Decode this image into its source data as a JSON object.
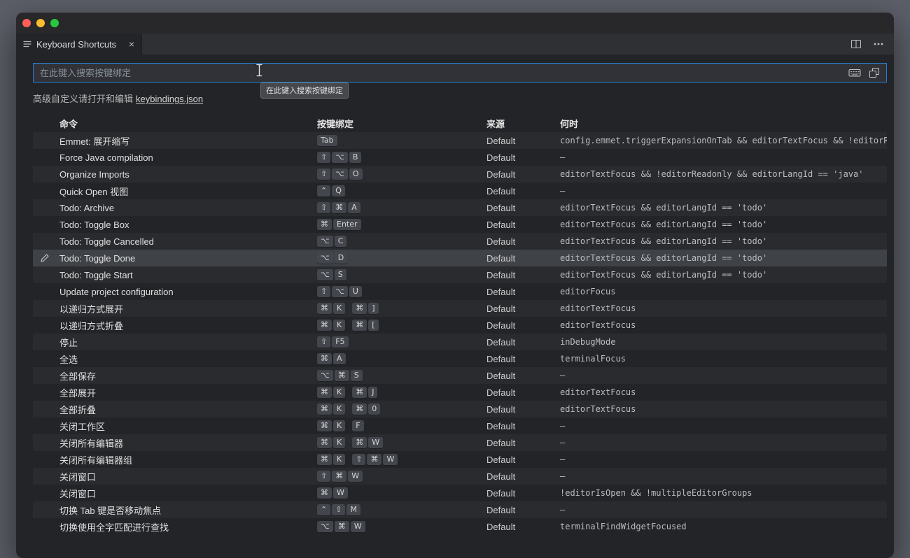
{
  "window": {
    "tab": {
      "label": "Keyboard Shortcuts",
      "close_glyph": "×"
    },
    "traffic_lights": {
      "close": "#ff5f57",
      "minimize": "#febc2e",
      "zoom": "#28c840"
    },
    "toolbar_icons": {
      "split_editor": "split-editor-icon",
      "more_actions": "more-actions-icon"
    }
  },
  "search": {
    "placeholder": "在此键入搜索按键绑定",
    "icons": {
      "record_keys": "keyboard-icon",
      "sort_by_precedence": "overlapping-squares-icon"
    }
  },
  "cursor_tooltip": {
    "text": "在此键入搜索按键绑定"
  },
  "advanced": {
    "text": "高级自定义请打开和编辑",
    "link": "keybindings.json"
  },
  "colors": {
    "focus_border": "#2a7ed2",
    "selected_row": "#3f4247",
    "alt_row": "#2a2b2f",
    "window_bg": "#232428"
  },
  "table": {
    "headers": {
      "command": "命令",
      "keybinding": "按键绑定",
      "source": "来源",
      "when": "何时"
    },
    "rows": [
      {
        "command": "Emmet: 展开缩写",
        "keys": [
          [
            "Tab"
          ]
        ],
        "source": "Default",
        "when": "config.emmet.triggerExpansionOnTab && editorTextFocus && !editorRe…"
      },
      {
        "command": "Force Java compilation",
        "keys": [
          [
            "⇧",
            "⌥",
            "B"
          ]
        ],
        "source": "Default",
        "when": "—"
      },
      {
        "command": "Organize Imports",
        "keys": [
          [
            "⇧",
            "⌥",
            "O"
          ]
        ],
        "source": "Default",
        "when": "editorTextFocus && !editorReadonly && editorLangId == 'java'"
      },
      {
        "command": "Quick Open 视图",
        "keys": [
          [
            "⌃",
            "Q"
          ]
        ],
        "source": "Default",
        "when": "—"
      },
      {
        "command": "Todo: Archive",
        "keys": [
          [
            "⇧",
            "⌘",
            "A"
          ]
        ],
        "source": "Default",
        "when": "editorTextFocus && editorLangId == 'todo'"
      },
      {
        "command": "Todo: Toggle Box",
        "keys": [
          [
            "⌘",
            "Enter"
          ]
        ],
        "source": "Default",
        "when": "editorTextFocus && editorLangId == 'todo'"
      },
      {
        "command": "Todo: Toggle Cancelled",
        "keys": [
          [
            "⌥",
            "C"
          ]
        ],
        "source": "Default",
        "when": "editorTextFocus && editorLangId == 'todo'"
      },
      {
        "command": "Todo: Toggle Done",
        "keys": [
          [
            "⌥",
            "D"
          ]
        ],
        "source": "Default",
        "when": "editorTextFocus && editorLangId == 'todo'",
        "selected": true
      },
      {
        "command": "Todo: Toggle Start",
        "keys": [
          [
            "⌥",
            "S"
          ]
        ],
        "source": "Default",
        "when": "editorTextFocus && editorLangId == 'todo'"
      },
      {
        "command": "Update project configuration",
        "keys": [
          [
            "⇧",
            "⌥",
            "U"
          ]
        ],
        "source": "Default",
        "when": "editorFocus"
      },
      {
        "command": "以递归方式展开",
        "keys": [
          [
            "⌘",
            "K"
          ],
          [
            "⌘",
            "]"
          ]
        ],
        "source": "Default",
        "when": "editorTextFocus"
      },
      {
        "command": "以递归方式折叠",
        "keys": [
          [
            "⌘",
            "K"
          ],
          [
            "⌘",
            "["
          ]
        ],
        "source": "Default",
        "when": "editorTextFocus"
      },
      {
        "command": "停止",
        "keys": [
          [
            "⇧",
            "F5"
          ]
        ],
        "source": "Default",
        "when": "inDebugMode"
      },
      {
        "command": "全选",
        "keys": [
          [
            "⌘",
            "A"
          ]
        ],
        "source": "Default",
        "when": "terminalFocus"
      },
      {
        "command": "全部保存",
        "keys": [
          [
            "⌥",
            "⌘",
            "S"
          ]
        ],
        "source": "Default",
        "when": "—"
      },
      {
        "command": "全部展开",
        "keys": [
          [
            "⌘",
            "K"
          ],
          [
            "⌘",
            "J"
          ]
        ],
        "source": "Default",
        "when": "editorTextFocus"
      },
      {
        "command": "全部折叠",
        "keys": [
          [
            "⌘",
            "K"
          ],
          [
            "⌘",
            "0"
          ]
        ],
        "source": "Default",
        "when": "editorTextFocus"
      },
      {
        "command": "关闭工作区",
        "keys": [
          [
            "⌘",
            "K"
          ],
          [
            "F"
          ]
        ],
        "source": "Default",
        "when": "—"
      },
      {
        "command": "关闭所有编辑器",
        "keys": [
          [
            "⌘",
            "K"
          ],
          [
            "⌘",
            "W"
          ]
        ],
        "source": "Default",
        "when": "—"
      },
      {
        "command": "关闭所有编辑器组",
        "keys": [
          [
            "⌘",
            "K"
          ],
          [
            "⇧",
            "⌘",
            "W"
          ]
        ],
        "source": "Default",
        "when": "—"
      },
      {
        "command": "关闭窗口",
        "keys": [
          [
            "⇧",
            "⌘",
            "W"
          ]
        ],
        "source": "Default",
        "when": "—"
      },
      {
        "command": "关闭窗口",
        "keys": [
          [
            "⌘",
            "W"
          ]
        ],
        "source": "Default",
        "when": "!editorIsOpen && !multipleEditorGroups"
      },
      {
        "command": "切换 Tab 键是否移动焦点",
        "keys": [
          [
            "⌃",
            "⇧",
            "M"
          ]
        ],
        "source": "Default",
        "when": "—"
      },
      {
        "command": "切换使用全字匹配进行查找",
        "keys": [
          [
            "⌥",
            "⌘",
            "W"
          ]
        ],
        "source": "Default",
        "when": "terminalFindWidgetFocused"
      }
    ]
  }
}
